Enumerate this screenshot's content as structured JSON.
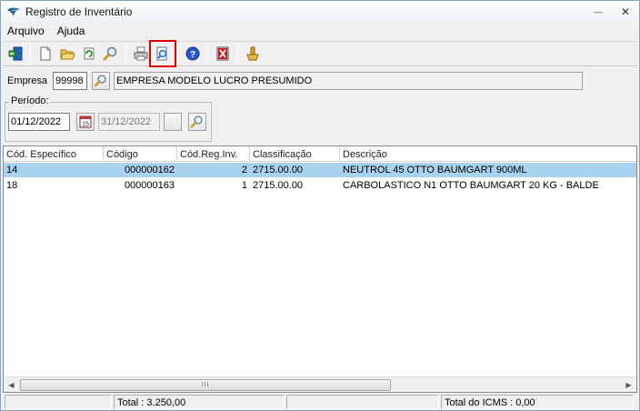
{
  "window": {
    "title": "Registro de Inventário",
    "minimize": "—",
    "close": "✕"
  },
  "menu": [
    "Arquivo",
    "Ajuda"
  ],
  "toolbar": {
    "buttons": [
      {
        "name": "exit-icon",
        "color": "#1f5fb5"
      },
      {
        "name": "new-document-icon",
        "color": "#ffffff"
      },
      {
        "name": "open-folder-icon",
        "color": "#e8b830"
      },
      {
        "name": "refresh-icon",
        "color": "#3a9a3a"
      },
      {
        "name": "search-icon",
        "color": "#c89b2a"
      },
      {
        "name": "printer-icon",
        "color": "#7a7a7a"
      },
      {
        "name": "print-preview-icon",
        "color": "#2f6fc9"
      },
      {
        "name": "help-icon",
        "color": "#2b55c9"
      },
      {
        "name": "delete-icon",
        "color": "#c81e1e"
      },
      {
        "name": "tools-icon",
        "color": "#d9a02a"
      }
    ],
    "highlighted_index": 6
  },
  "empresa": {
    "label": "Empresa",
    "code": "99998",
    "name": "EMPRESA MODELO LUCRO PRESUMIDO"
  },
  "periodo": {
    "legend": "Período:",
    "start": "01/12/2022",
    "end": "31/12/2022",
    "calendar_day": "15"
  },
  "grid": {
    "columns": [
      "Cód. Específico",
      "Código",
      "Cód.Reg.Inv.",
      "Classificação",
      "Descrição"
    ],
    "rows": [
      {
        "especifico": "14",
        "codigo": "000000162",
        "reginv": "2",
        "classificacao": "2715.00.00",
        "descricao": "NEUTROL 45 OTTO BAUMGART 900ML",
        "selected": true
      },
      {
        "especifico": "18",
        "codigo": "000000163",
        "reginv": "1",
        "classificacao": "2715.00.00",
        "descricao": "CARBOLASTICO N1 OTTO BAUMGART 20 KG - BALDE",
        "selected": false
      }
    ],
    "scroll_thumb_grip": "III"
  },
  "status": {
    "total": "Total : 3.250,00",
    "total_icms": "Total do ICMS : 0,00"
  }
}
